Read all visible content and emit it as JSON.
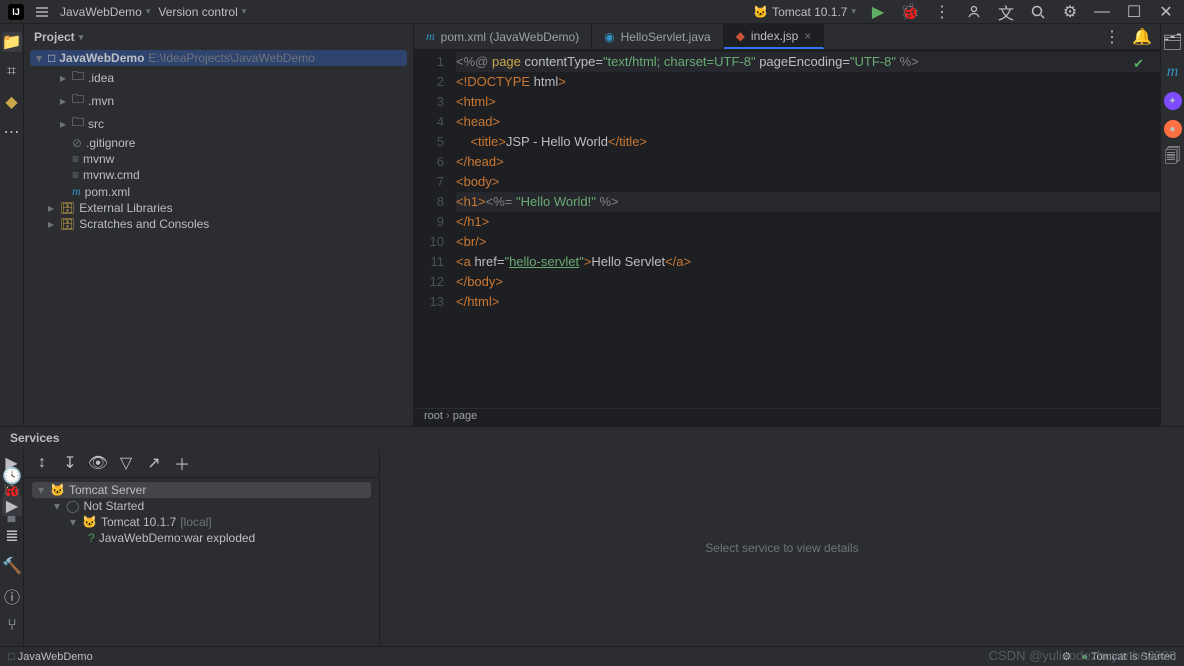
{
  "titlebar": {
    "project_name": "JavaWebDemo",
    "version_control_label": "Version control",
    "run_config_name": "Tomcat 10.1.7"
  },
  "left_tools": [
    "project",
    "structure",
    "bookmarks",
    "profiler",
    "more"
  ],
  "project_pane": {
    "title": "Project",
    "root": {
      "name": "JavaWebDemo",
      "path": "E:\\IdeaProjects\\JavaWebDemo"
    },
    "items": [
      {
        "name": ".idea",
        "kind": "folder",
        "indent": 2,
        "expandable": true
      },
      {
        "name": ".mvn",
        "kind": "folder",
        "indent": 2,
        "expandable": true
      },
      {
        "name": "src",
        "kind": "folder",
        "indent": 2,
        "expandable": true
      },
      {
        "name": ".gitignore",
        "kind": "ignore",
        "indent": 2,
        "expandable": false
      },
      {
        "name": "mvnw",
        "kind": "file",
        "indent": 2,
        "expandable": false
      },
      {
        "name": "mvnw.cmd",
        "kind": "file",
        "indent": 2,
        "expandable": false
      },
      {
        "name": "pom.xml",
        "kind": "maven",
        "indent": 2,
        "expandable": false
      }
    ],
    "extra": [
      {
        "name": "External Libraries",
        "indent": 1
      },
      {
        "name": "Scratches and Consoles",
        "indent": 1
      }
    ]
  },
  "editor_tabs": [
    {
      "label": "pom.xml (JavaWebDemo)",
      "icon": "maven",
      "active": false,
      "closable": false
    },
    {
      "label": "HelloServlet.java",
      "icon": "java",
      "active": false,
      "closable": false
    },
    {
      "label": "index.jsp",
      "icon": "jsp",
      "active": true,
      "closable": true
    }
  ],
  "editor": {
    "line_count": 13,
    "lines_html": [
      "<span class='grey'>&lt;%@ </span><span class='fn'>page</span><span class='txt'> </span><span class='txt'>contentType</span><span class='txt'>=</span><span class='str'>\"text/html; charset=UTF-8\"</span><span class='txt'> pageEncoding=</span><span class='str'>\"UTF-8\"</span><span class='grey'> %&gt;</span>",
      "<span class='tag'>&lt;!DOCTYPE </span><span class='txt'>html</span><span class='tag'>&gt;</span>",
      "<span class='tag'>&lt;html&gt;</span>",
      "<span class='tag'>&lt;head&gt;</span>",
      "    <span class='tag'>&lt;title&gt;</span><span class='txt'>JSP - Hello World</span><span class='tag'>&lt;/title&gt;</span>",
      "<span class='tag'>&lt;/head&gt;</span>",
      "<span class='tag'>&lt;body&gt;</span>",
      "<span class='tag'>&lt;h1&gt;</span><span class='grey'>&lt;%=</span><span class='txt'> </span><span class='str'>\"Hello World!\"</span><span class='txt'> </span><span class='grey'>%&gt;</span>",
      "<span class='tag'>&lt;/h1&gt;</span>",
      "<span class='tag'>&lt;br/&gt;</span>",
      "<span class='tag'>&lt;a </span><span class='txt'>href=</span><span class='str'>\"<span class='link'>hello-servlet</span>\"</span><span class='tag'>&gt;</span><span class='txt'>Hello Servlet</span><span class='tag'>&lt;/a&gt;</span>",
      "<span class='tag'>&lt;/body&gt;</span>",
      "<span class='tag'>&lt;/html&gt;</span>"
    ],
    "breadcrumb": {
      "a": "root",
      "sep": " › ",
      "b": "page"
    }
  },
  "services": {
    "title": "Services",
    "tree": {
      "root": "Tomcat Server",
      "not_started": "Not Started",
      "config": "Tomcat 10.1.7",
      "config_suffix": "[local]",
      "artifact": "JavaWebDemo:war exploded"
    },
    "detail_placeholder": "Select service to view details"
  },
  "statusbar": {
    "branch": "JavaWebDemo",
    "right_status": "Tomcat is Started"
  },
  "watermark": "CSDN @yuliaodezhuyanhe2020",
  "colors": {
    "accent": "#3574f0",
    "bg": "#2b2d30",
    "editor_bg": "#1e1f22"
  }
}
